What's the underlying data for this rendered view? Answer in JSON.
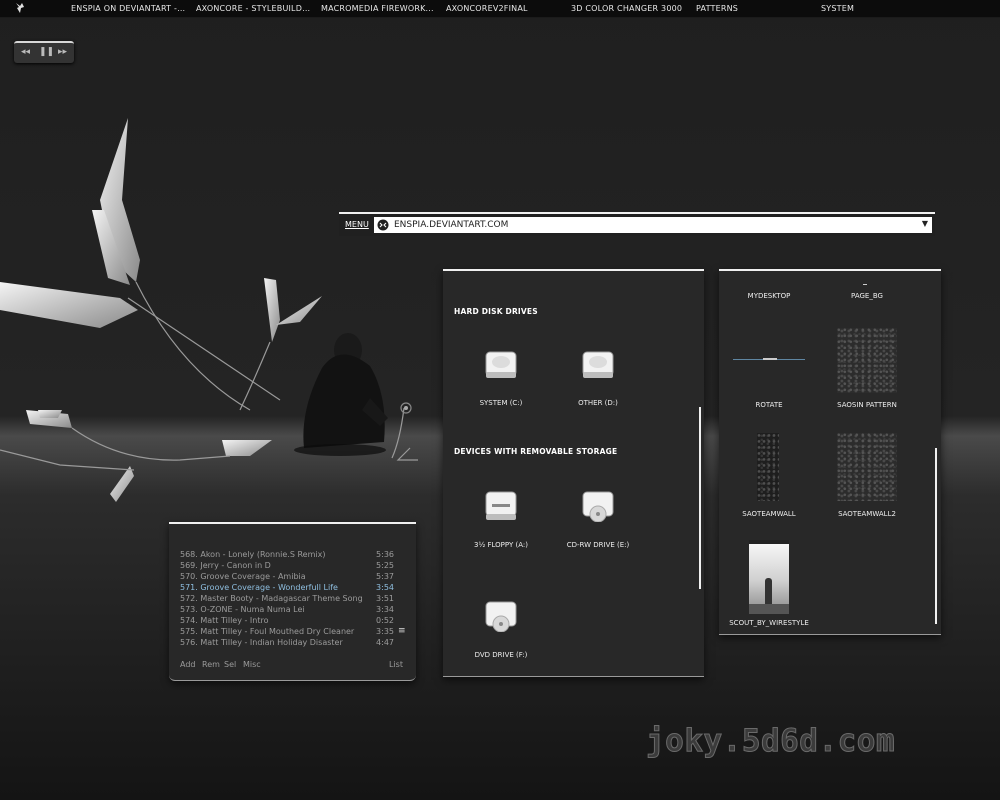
{
  "taskbar": {
    "items": [
      {
        "label": "ENSPIA ON DEVIANTART -..."
      },
      {
        "label": "AXONCORE - STYLEBUILD..."
      },
      {
        "label": "MACROMEDIA FIREWORK..."
      },
      {
        "label": "AXONCOREV2FINAL"
      },
      {
        "label": "3D COLOR CHANGER 3000"
      },
      {
        "label": "PATTERNS"
      },
      {
        "label": "SYSTEM"
      }
    ]
  },
  "player": {
    "prev_icon": "rewind-icon",
    "pause_icon": "pause-icon",
    "next_icon": "fast-forward-icon",
    "prev": "◂◂",
    "pause": "❚❚",
    "next": "▸▸"
  },
  "browser": {
    "menu_label": "MENU",
    "address": "ENSPIA.DEVIANTART.COM",
    "dropdown": "▼"
  },
  "drives": {
    "hard_disk_title": "HARD DISK DRIVES",
    "removable_title": "DEVICES WITH REMOVABLE STORAGE",
    "hard_disks": [
      {
        "label": "SYSTEM (C:)"
      },
      {
        "label": "OTHER (D:)"
      }
    ],
    "removable": [
      {
        "label": "3½ FLOPPY (A:)"
      },
      {
        "label": "CD-RW DRIVE (E:)"
      },
      {
        "label": "DVD DRIVE (F:)"
      }
    ]
  },
  "files": {
    "items": [
      {
        "label": "MYDESKTOP"
      },
      {
        "label": "PAGE_BG"
      },
      {
        "label": "ROTATE"
      },
      {
        "label": "SAOSIN PATTERN"
      },
      {
        "label": "SAOTEAMWALL"
      },
      {
        "label": "SAOTEAMWALL2"
      },
      {
        "label": "SCOUT_BY_WIRESTYLE"
      }
    ]
  },
  "playlist": {
    "tracks": [
      {
        "title": "568. Akon - Lonely (Ronnie.S Remix)",
        "time": "5:36"
      },
      {
        "title": "569. Jerry - Canon in D",
        "time": "5:25"
      },
      {
        "title": "570. Groove Coverage - Amibia",
        "time": "5:37"
      },
      {
        "title": "571. Groove Coverage - Wonderfull Life",
        "time": "3:54",
        "current": true
      },
      {
        "title": "572. Master Booty - Madagascar Theme Song",
        "time": "3:51"
      },
      {
        "title": "573. O-ZONE - Numa Numa Lei",
        "time": "3:34"
      },
      {
        "title": "574. Matt Tilley - Intro",
        "time": "0:52"
      },
      {
        "title": "575. Matt Tilley - Foul Mouthed Dry Cleaner",
        "time": "3:35"
      },
      {
        "title": "576. Matt Tilley - Indian Holiday Disaster",
        "time": "4:47"
      }
    ],
    "controls": {
      "add": "Add",
      "rem": "Rem",
      "sel": "Sel",
      "misc": "Misc",
      "list": "List"
    },
    "scroll_glyph": "≡"
  },
  "watermark": "joky.5d6d.com",
  "colors": {
    "accent_current_track": "#8fbfe0",
    "panel_bg": "#282828",
    "panel_top_border": "#f0f0f0"
  }
}
